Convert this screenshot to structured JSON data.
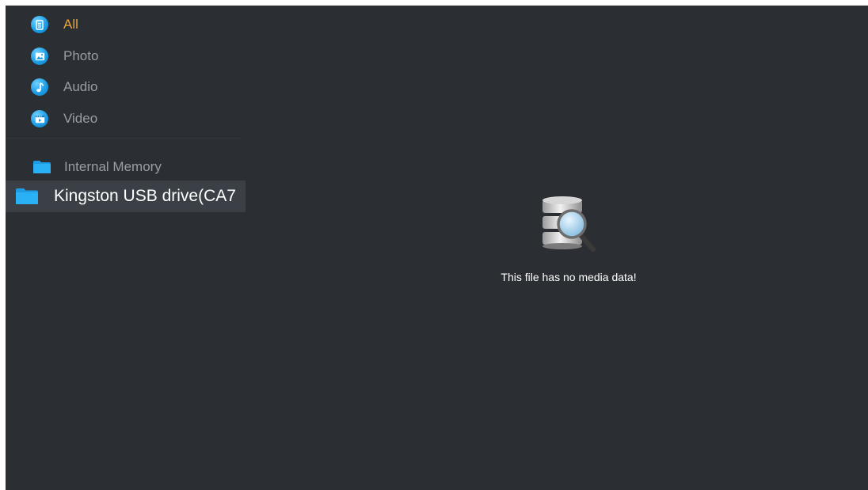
{
  "categories": [
    {
      "label": "All",
      "icon": "document-icon",
      "active": true
    },
    {
      "label": "Photo",
      "icon": "photo-icon",
      "active": false
    },
    {
      "label": "Audio",
      "icon": "music-note-icon",
      "active": false
    },
    {
      "label": "Video",
      "icon": "video-icon",
      "active": false
    }
  ],
  "storage": {
    "internal_label": "Internal Memory",
    "usb_label": "Kingston USB drive(CA7"
  },
  "empty_state": {
    "icon": "database-search-icon",
    "message": "This file has no media data!"
  },
  "colors": {
    "background": "#2b2f33",
    "active_text": "#e8a33a",
    "inactive_text": "#9a9ea3",
    "selected_row": "#3b4046",
    "icon_blue": "#1d9ee6"
  }
}
